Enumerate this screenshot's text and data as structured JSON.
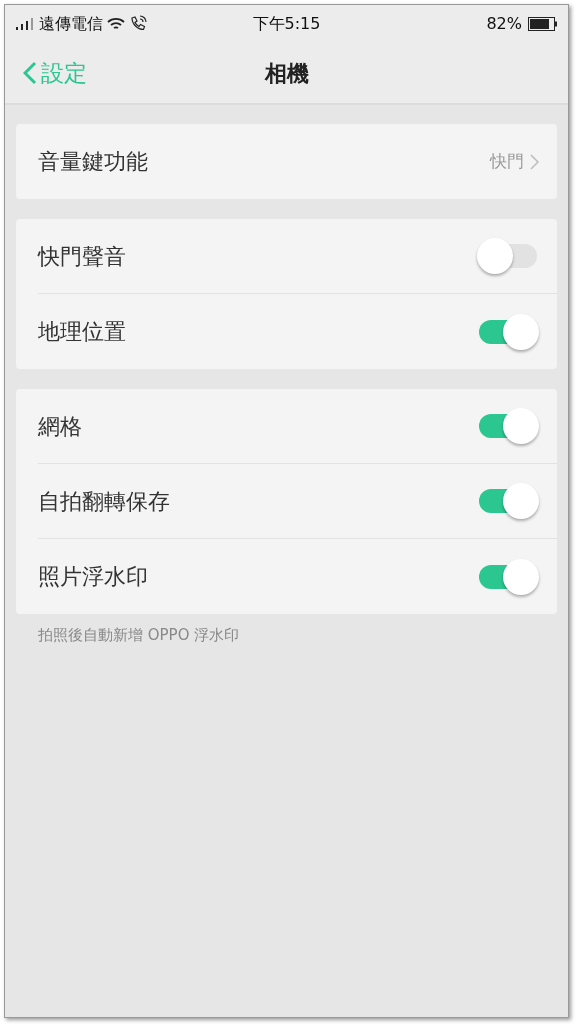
{
  "status_bar": {
    "carrier": "遠傳電信",
    "time": "下午5:15",
    "battery": "82%"
  },
  "nav": {
    "back": "設定",
    "title": "相機"
  },
  "groups": [
    {
      "rows": [
        {
          "kind": "link",
          "label": "音量鍵功能",
          "value": "快門"
        }
      ]
    },
    {
      "rows": [
        {
          "kind": "toggle",
          "label": "快門聲音",
          "on": false
        },
        {
          "kind": "toggle",
          "label": "地理位置",
          "on": true
        }
      ]
    },
    {
      "rows": [
        {
          "kind": "toggle",
          "label": "網格",
          "on": true
        },
        {
          "kind": "toggle",
          "label": "自拍翻轉保存",
          "on": true
        },
        {
          "kind": "toggle",
          "label": "照片浮水印",
          "on": true
        }
      ],
      "footer": "拍照後自動新增 OPPO 浮水印"
    }
  ]
}
